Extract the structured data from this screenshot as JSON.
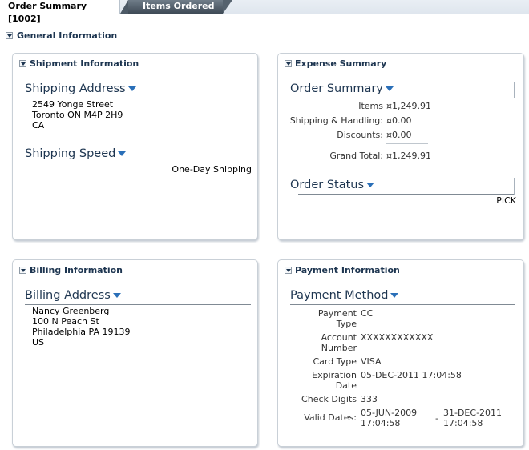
{
  "tabs": [
    {
      "label": "Order Summary [1002]",
      "active": true
    },
    {
      "label": "Items Ordered",
      "active": false
    }
  ],
  "general": {
    "title": "General Information"
  },
  "shipment": {
    "title": "Shipment Information",
    "address_heading": "Shipping Address",
    "address_lines": [
      "2549 Yonge Street",
      "Toronto   ON   M4P 2H9",
      "CA"
    ],
    "speed_heading": "Shipping Speed",
    "speed_value": "One-Day Shipping"
  },
  "expense": {
    "title": "Expense Summary",
    "order_heading": "Order Summary",
    "rows": [
      {
        "label": "Items",
        "value": "¤1,249.91"
      },
      {
        "label": "Shipping & Handling:",
        "value": "¤0.00"
      },
      {
        "label": "Discounts:",
        "value": "¤0.00"
      },
      {
        "label": "Grand Total:",
        "value": "¤1,249.91"
      }
    ],
    "status_heading": "Order Status",
    "status_value": "PICK"
  },
  "billing": {
    "title": "Billing Information",
    "address_heading": "Billing Address",
    "address_lines": [
      "Nancy   Greenberg",
      "100 N Peach St",
      "Philadelphia   PA   19139",
      "US"
    ]
  },
  "payment": {
    "title": "Payment Information",
    "method_heading": "Payment Method",
    "payment_type_label": "Payment Type",
    "payment_type_value": "CC",
    "account_label": "Account Number",
    "account_value": "XXXXXXXXXXXX",
    "card_type_label": "Card Type",
    "card_type_value": "VISA",
    "expiration_label": "Expiration Date",
    "expiration_value": "05-DEC-2011 17:04:58",
    "check_digits_label": "Check Digits",
    "check_digits_value": "333",
    "valid_dates_label": "Valid Dates:",
    "valid_from": "05-JUN-2009 17:04:58",
    "valid_sep": "-",
    "valid_to": "31-DEC-2011 17:04:58"
  },
  "colors": {
    "heading": "#1d3550",
    "caret": "#2a6fb8",
    "tab_inactive": "#4d5a66"
  }
}
